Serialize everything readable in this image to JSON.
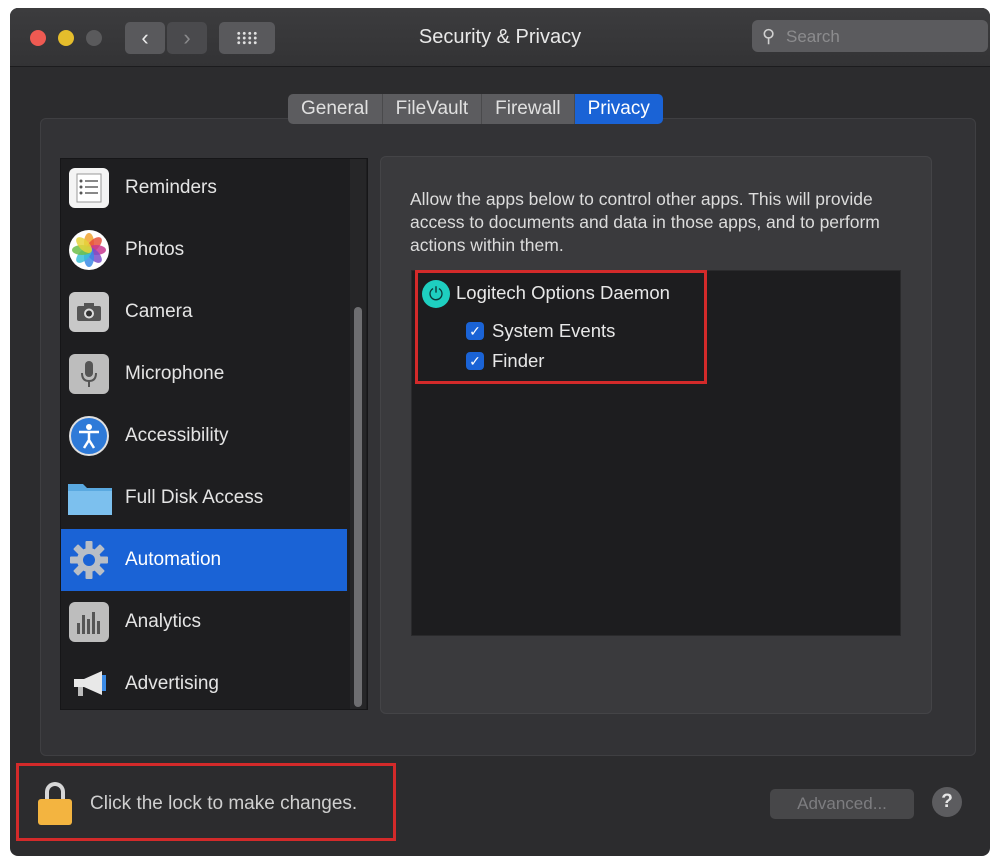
{
  "window": {
    "title": "Security & Privacy"
  },
  "search": {
    "placeholder": "Search"
  },
  "tabs": [
    {
      "label": "General"
    },
    {
      "label": "FileVault"
    },
    {
      "label": "Firewall"
    },
    {
      "label": "Privacy",
      "active": true
    }
  ],
  "sidebar": {
    "items": [
      {
        "label": "Reminders",
        "icon": "reminders-icon"
      },
      {
        "label": "Photos",
        "icon": "photos-icon"
      },
      {
        "label": "Camera",
        "icon": "camera-icon"
      },
      {
        "label": "Microphone",
        "icon": "microphone-icon"
      },
      {
        "label": "Accessibility",
        "icon": "accessibility-icon"
      },
      {
        "label": "Full Disk Access",
        "icon": "folder-icon"
      },
      {
        "label": "Automation",
        "icon": "gear-icon",
        "selected": true
      },
      {
        "label": "Analytics",
        "icon": "analytics-icon"
      },
      {
        "label": "Advertising",
        "icon": "megaphone-icon"
      }
    ]
  },
  "main": {
    "description": "Allow the apps below to control other apps. This will provide access to documents and data in those apps, and to perform actions within them.",
    "app": {
      "name": "Logitech Options Daemon",
      "icon": "logitech-icon",
      "permissions": [
        {
          "label": "System Events",
          "checked": true
        },
        {
          "label": "Finder",
          "checked": true
        }
      ]
    }
  },
  "footer": {
    "lock_text": "Click the lock to make changes.",
    "advanced_label": "Advanced...",
    "help_label": "?"
  },
  "colors": {
    "accent": "#1a63d6",
    "highlight_border": "#d32a2a",
    "window_bg": "#2c2c2e"
  }
}
